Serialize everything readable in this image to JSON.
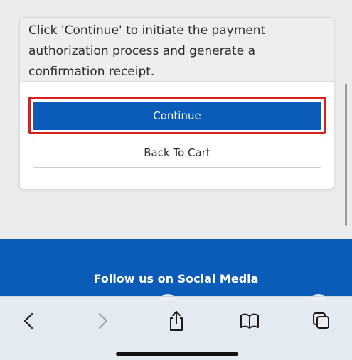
{
  "card": {
    "message": "Click 'Continue' to initiate the payment authorization process and generate a confirmation receipt.",
    "continue_label": "Continue",
    "back_label": "Back To Cart"
  },
  "footer": {
    "social_title": "Follow us on Social Media"
  },
  "browser_toolbar": {
    "icons": [
      "back-arrow-icon",
      "forward-arrow-icon",
      "share-icon",
      "bookmarks-icon",
      "tabs-icon"
    ]
  },
  "colors": {
    "primary_button": "#0a5cb8",
    "footer_background": "#0a5cb8",
    "highlight_border": "#d9201a",
    "disabled_icon": "#9aa3ad",
    "active_icon": "#1c1c1e"
  }
}
